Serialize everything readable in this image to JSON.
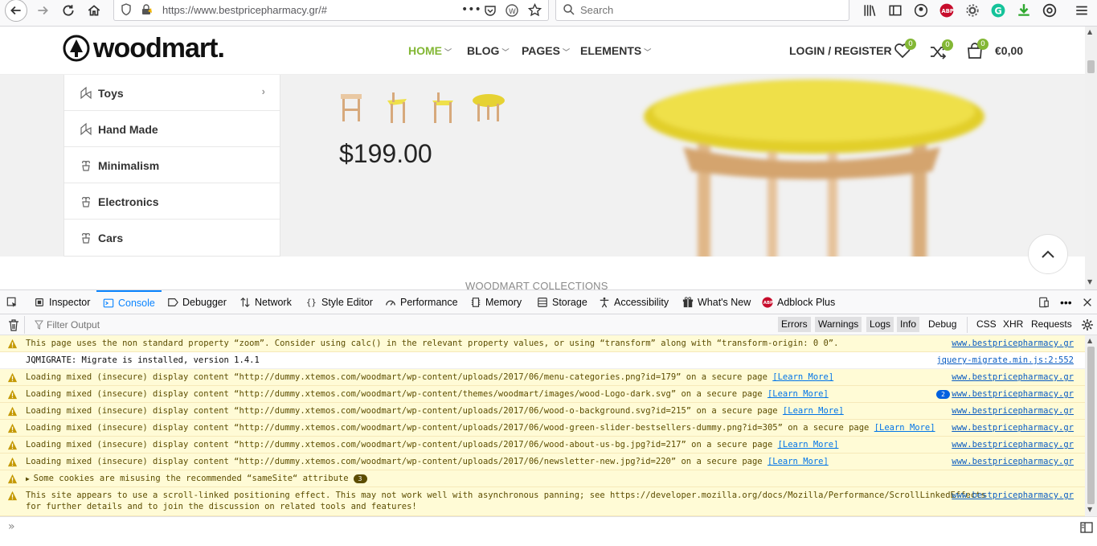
{
  "browser": {
    "url": "https://www.bestpricepharmacy.gr/#",
    "search_placeholder": "Search"
  },
  "site": {
    "logo": "woodmart.",
    "nav": [
      {
        "label": "HOME",
        "active": true
      },
      {
        "label": "BLOG"
      },
      {
        "label": "PAGES"
      },
      {
        "label": "ELEMENTS"
      }
    ],
    "login": "LOGIN / REGISTER",
    "wishlist_count": "0",
    "compare_count": "0",
    "cart_count": "0",
    "cart_total": "€0,00",
    "categories": [
      {
        "label": "Toys",
        "has_arrow": true
      },
      {
        "label": "Hand Made"
      },
      {
        "label": "Minimalism"
      },
      {
        "label": "Electronics"
      },
      {
        "label": "Cars"
      }
    ],
    "price": "$199.00",
    "collections_heading": "WOODMART COLLECTIONS",
    "accent_color": "#83b735"
  },
  "devtools": {
    "tabs": [
      {
        "label": "Inspector",
        "icon": "inspector-icon"
      },
      {
        "label": "Console",
        "icon": "console-icon",
        "active": true
      },
      {
        "label": "Debugger",
        "icon": "debugger-icon"
      },
      {
        "label": "Network",
        "icon": "network-icon"
      },
      {
        "label": "Style Editor",
        "icon": "style-editor-icon"
      },
      {
        "label": "Performance",
        "icon": "performance-icon"
      },
      {
        "label": "Memory",
        "icon": "memory-icon"
      },
      {
        "label": "Storage",
        "icon": "storage-icon"
      },
      {
        "label": "Accessibility",
        "icon": "accessibility-icon"
      },
      {
        "label": "What's New",
        "icon": "gift-icon"
      },
      {
        "label": "Adblock Plus",
        "icon": "abp-icon"
      }
    ],
    "filter_placeholder": "Filter Output",
    "filters": [
      {
        "label": "Errors",
        "on": true
      },
      {
        "label": "Warnings",
        "on": true
      },
      {
        "label": "Logs",
        "on": true
      },
      {
        "label": "Info",
        "on": true
      },
      {
        "label": "Debug",
        "on": false
      }
    ],
    "net_filters": [
      "CSS",
      "XHR",
      "Requests"
    ],
    "messages": [
      {
        "type": "warn",
        "text": "This page uses the non standard property “zoom”. Consider using calc() in the relevant property values, or using “transform” along with “transform-origin: 0 0”.",
        "source": "www.bestpricepharmacy.gr"
      },
      {
        "type": "log",
        "text": "JQMIGRATE: Migrate is installed, version 1.4.1",
        "source": "jquery-migrate.min.js:2:552"
      },
      {
        "type": "warn",
        "text": "Loading mixed (insecure) display content “http://dummy.xtemos.com/woodmart/wp-content/uploads/2017/06/menu-categories.png?id=179” on a secure page",
        "learn": "[Learn More]",
        "source": "www.bestpricepharmacy.gr"
      },
      {
        "type": "warn",
        "text": "Loading mixed (insecure) display content “http://dummy.xtemos.com/woodmart/wp-content/themes/woodmart/images/wood-Logo-dark.svg” on a secure page",
        "learn": "[Learn More]",
        "count": "2",
        "source": "www.bestpricepharmacy.gr"
      },
      {
        "type": "warn",
        "text": "Loading mixed (insecure) display content “http://dummy.xtemos.com/woodmart/wp-content/uploads/2017/06/wood-o-background.svg?id=215” on a secure page",
        "learn": "[Learn More]",
        "source": "www.bestpricepharmacy.gr"
      },
      {
        "type": "warn",
        "text": "Loading mixed (insecure) display content “http://dummy.xtemos.com/woodmart/wp-content/uploads/2017/06/wood-green-slider-bestsellers-dummy.png?id=305” on a secure page",
        "learn": "[Learn More]",
        "source": "www.bestpricepharmacy.gr"
      },
      {
        "type": "warn",
        "text": "Loading mixed (insecure) display content “http://dummy.xtemos.com/woodmart/wp-content/uploads/2017/06/wood-about-us-bg.jpg?id=217” on a secure page",
        "learn": "[Learn More]",
        "source": "www.bestpricepharmacy.gr"
      },
      {
        "type": "warn",
        "text": "Loading mixed (insecure) display content “http://dummy.xtemos.com/woodmart/wp-content/uploads/2017/06/newsletter-new.jpg?id=220” on a secure page",
        "learn": "[Learn More]",
        "source": "www.bestpricepharmacy.gr"
      },
      {
        "type": "warn",
        "text": "Some cookies are misusing the recommended “sameSite“ attribute",
        "group_count": "3",
        "source": ""
      },
      {
        "type": "warn",
        "text": "This site appears to use a scroll-linked positioning effect. This may not work well with asynchronous panning; see https://developer.mozilla.org/docs/Mozilla/Performance/ScrollLinkedEffects",
        "text2": "for further details and to join the discussion on related tools and features!",
        "source": "www.bestpricepharmacy.gr"
      }
    ]
  }
}
